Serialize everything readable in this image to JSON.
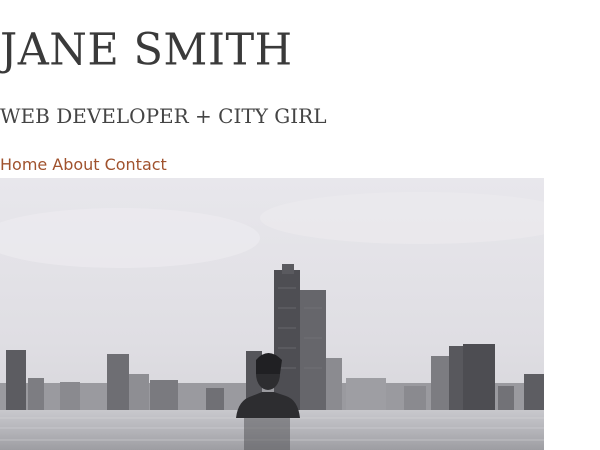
{
  "header": {
    "title": "JANE SMITH",
    "tagline": "WEB DEVELOPER + CITY GIRL"
  },
  "nav": {
    "items": [
      {
        "label": "Home"
      },
      {
        "label": "About"
      },
      {
        "label": "Contact"
      }
    ]
  },
  "hero": {
    "alt": "Woman in an infinity pool overlooking a city skyline",
    "style": "grayscale photo"
  },
  "colors": {
    "link": "#a0522d",
    "title": "#3a3a3a",
    "background": "#ffffff"
  }
}
